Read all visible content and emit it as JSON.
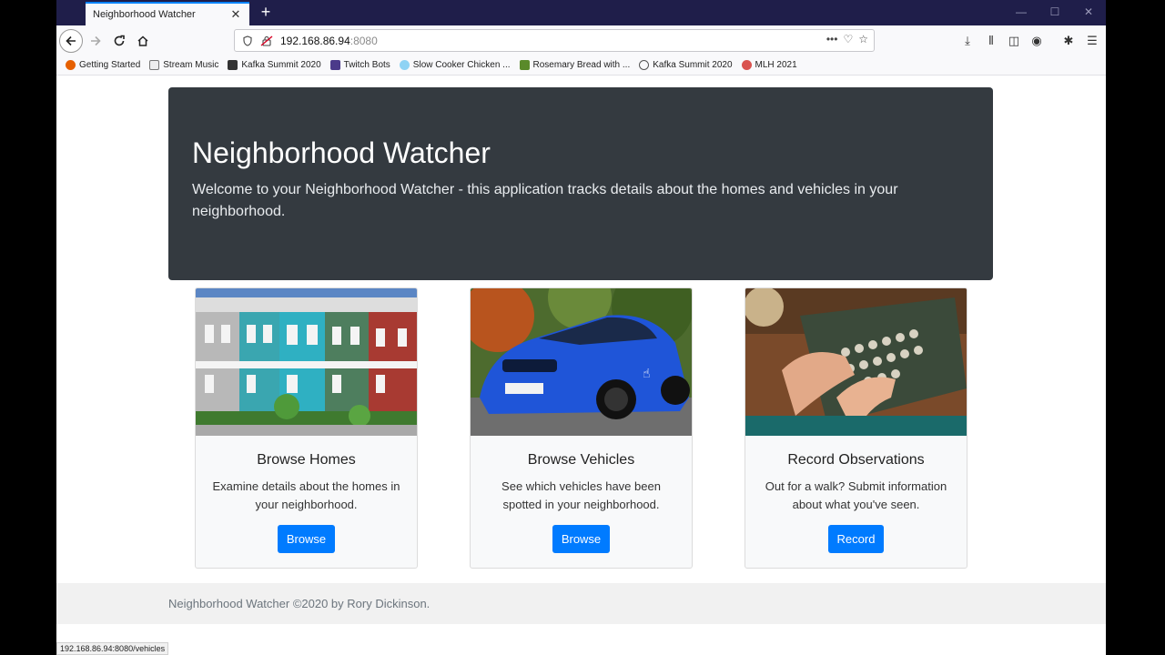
{
  "browser": {
    "tab_title": "Neighborhood Watcher",
    "tab_close": "✕",
    "new_tab": "+",
    "url_host": "192.168.86.94",
    "url_port": ":8080",
    "status_url": "192.168.86.94:8080/vehicles",
    "bookmarks": [
      {
        "label": "Getting Started",
        "color": "#e66000"
      },
      {
        "label": "Stream Music",
        "color": "#888888"
      },
      {
        "label": "Kafka Summit 2020",
        "color": "#333333"
      },
      {
        "label": "Twitch Bots",
        "color": "#4b3a8a"
      },
      {
        "label": "Slow Cooker Chicken ...",
        "color": "#8fd3f4"
      },
      {
        "label": "Rosemary Bread with ...",
        "color": "#5a8a2a"
      },
      {
        "label": "Kafka Summit 2020",
        "color": "#555555"
      },
      {
        "label": "MLH 2021",
        "color": "#d9534f"
      }
    ]
  },
  "jumbotron": {
    "title": "Neighborhood Watcher",
    "lead": "Welcome to your Neighborhood Watcher - this application tracks details about the homes and vehicles in your neighborhood."
  },
  "cards": [
    {
      "title": "Browse Homes",
      "text": "Examine details about the homes in your neighborhood.",
      "button": "Browse"
    },
    {
      "title": "Browse Vehicles",
      "text": "See which vehicles have been spotted in your neighborhood.",
      "button": "Browse"
    },
    {
      "title": "Record Observations",
      "text": "Out for a walk? Submit information about what you've seen.",
      "button": "Record"
    }
  ],
  "footer": {
    "text": "Neighborhood Watcher ©2020 by Rory Dickinson."
  }
}
